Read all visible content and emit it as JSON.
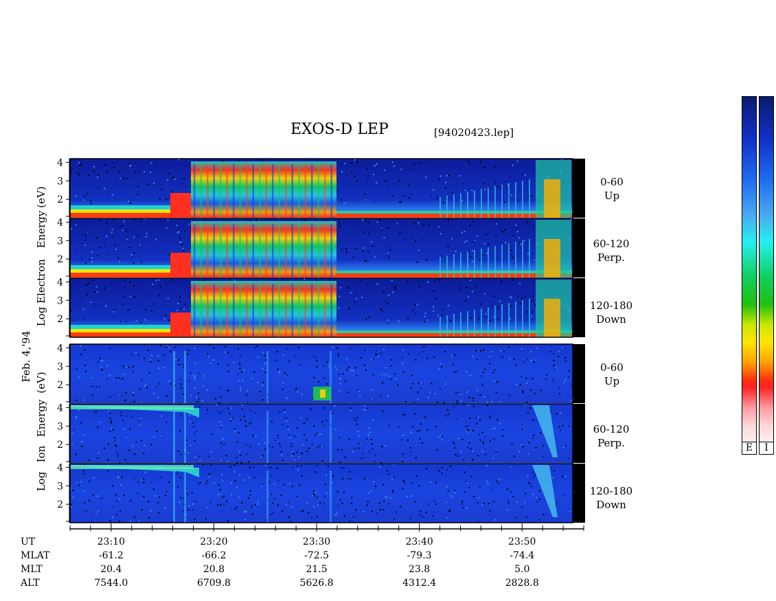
{
  "title": "EXOS-D LEP",
  "filename": "[94020423.lep]",
  "date_label": "Feb. 4,'94",
  "electron_ylabel": [
    "Log",
    "Electron",
    "Energy",
    "(eV)"
  ],
  "ion_ylabel": [
    "Log",
    "Ion",
    "Energy",
    "(eV)"
  ],
  "channels": [
    {
      "range": "0-60",
      "dir": "Up"
    },
    {
      "range": "60-120",
      "dir": "Perp."
    },
    {
      "range": "120-180",
      "dir": "Down"
    }
  ],
  "colorbar_labels": [
    "E",
    "I"
  ],
  "colors": {
    "background": "#0b1fa8",
    "panel_bg_low": "#1a3cd8",
    "right_strip": "#000000"
  },
  "time_axis": {
    "row_labels": [
      "UT",
      "MLAT",
      "MLT",
      "ALT"
    ],
    "UT": [
      "23:10",
      "23:20",
      "23:30",
      "23:40",
      "23:50"
    ],
    "MLAT": [
      "-61.2",
      "-66.2",
      "-72.5",
      "-79.3",
      "-74.4"
    ],
    "MLT": [
      "20.4",
      "20.8",
      "21.5",
      "23.8",
      "5.0"
    ],
    "ALT": [
      "7544.0",
      "6709.8",
      "5626.8",
      "4312.4",
      "2828.8"
    ]
  },
  "chart_data": {
    "type": "heatmap",
    "title": "EXOS-D LEP",
    "x_axis": {
      "label": "UT",
      "range": [
        "23:06",
        "23:56"
      ],
      "ticks": [
        "23:10",
        "23:20",
        "23:30",
        "23:40",
        "23:50"
      ]
    },
    "y_axis": {
      "label": "Log Energy (eV)",
      "range": [
        1,
        4.2
      ],
      "ticks": [
        2,
        3,
        4
      ]
    },
    "panels": [
      {
        "species": "Electron",
        "channel": "0-60",
        "direction": "Up"
      },
      {
        "species": "Electron",
        "channel": "60-120",
        "direction": "Perp."
      },
      {
        "species": "Electron",
        "channel": "120-180",
        "direction": "Down"
      },
      {
        "species": "Ion",
        "channel": "0-60",
        "direction": "Up"
      },
      {
        "species": "Ion",
        "channel": "60-120",
        "direction": "Perp."
      },
      {
        "species": "Ion",
        "channel": "120-180",
        "direction": "Down"
      }
    ]
  }
}
